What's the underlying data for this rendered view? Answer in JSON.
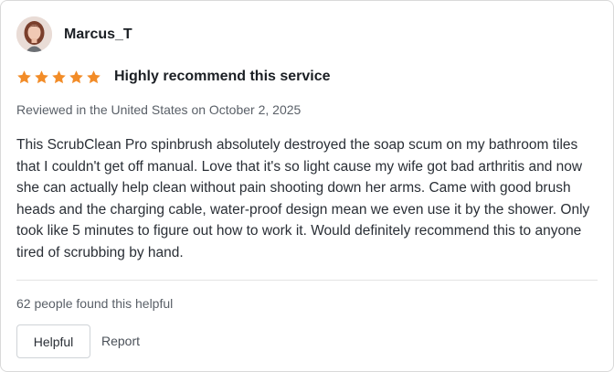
{
  "review": {
    "username": "Marcus_T",
    "rating": 5,
    "rating_max": 5,
    "star_color": "#f28c28",
    "title": "Highly recommend this service",
    "meta": "Reviewed in the United States on October 2, 2025",
    "body": "This ScrubClean Pro spinbrush absolutely destroyed the soap scum on my bathroom tiles that I couldn't get off manual. Love that it's so light cause my wife got bad arthritis and now she can actually help clean without pain shooting down her arms. Came with good brush heads and the charging cable, water-proof design mean we even use it by the shower. Only took like 5 minutes to figure out how to work it. Would definitely recommend this to anyone tired of scrubbing by hand.",
    "helpful_count": "62 people found this helpful"
  },
  "actions": {
    "helpful_label": "Helpful",
    "report_label": "Report"
  }
}
